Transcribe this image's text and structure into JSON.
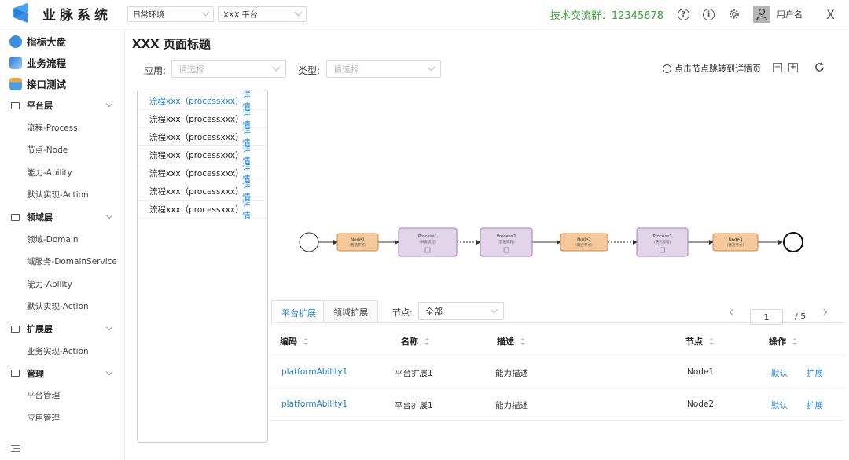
{
  "app": {
    "title": "业脉系统"
  },
  "header": {
    "env_select": "日常环境",
    "platform_select": "XXX 平台",
    "contact": "技术交流群：12345678",
    "help_glyph": "?",
    "info_glyph": "i",
    "username": "用户名",
    "close_glyph": "X"
  },
  "sidebar": {
    "top_items": [
      {
        "label": "指标大盘",
        "icon": "dashboard-icon",
        "color": "#3b8fe0"
      },
      {
        "label": "业务流程",
        "icon": "flow-icon",
        "color": "#2b78d4"
      },
      {
        "label": "接口测试",
        "icon": "api-test-icon",
        "color": "#4a9ee8"
      }
    ],
    "groups": [
      {
        "label": "平台层",
        "items": [
          "流程-Process",
          "节点-Node",
          "能力-Ability",
          "默认实现-Action"
        ]
      },
      {
        "label": "领域层",
        "items": [
          "领域-Domain",
          "域服务-DomainService",
          "能力-Ability",
          "默认实现-Action"
        ]
      },
      {
        "label": "扩展层",
        "items": [
          "业务实现-Action"
        ]
      },
      {
        "label": "管理",
        "items": [
          "平台管理",
          "应用管理"
        ]
      }
    ]
  },
  "main": {
    "page_title": "XXX 页面标题",
    "filters": {
      "app_label": "应用:",
      "app_placeholder": "请选择",
      "type_label": "类型:",
      "type_placeholder": "请选择"
    },
    "hint": "点击节点跳转到详情页",
    "zoom_out": "−",
    "zoom_in": "+",
    "process_list": [
      {
        "name": "流程xxx（processxxx）",
        "detail": "详情",
        "active": true
      },
      {
        "name": "流程xxx（processxxx）",
        "detail": "详情",
        "active": false
      },
      {
        "name": "流程xxx（processxxx）",
        "detail": "详情",
        "active": false
      },
      {
        "name": "流程xxx（processxxx）",
        "detail": "详情",
        "active": false
      },
      {
        "name": "流程xxx（processxxx）",
        "detail": "详情",
        "active": false
      },
      {
        "name": "流程xxx（processxxx）",
        "detail": "详情",
        "active": false
      },
      {
        "name": "流程xxx（processxxx）",
        "detail": "详情",
        "active": false
      }
    ],
    "flow_nodes": [
      {
        "title": "Node1",
        "sub": "(普通节点)",
        "kind": "node"
      },
      {
        "title": "Process1",
        "sub": "(并发流程)",
        "kind": "process"
      },
      {
        "title": "Process2",
        "sub": "(普通流程)",
        "kind": "process"
      },
      {
        "title": "Node2",
        "sub": "(聚合节点)",
        "kind": "node"
      },
      {
        "title": "Process3",
        "sub": "(迭代流程)",
        "kind": "process"
      },
      {
        "title": "Node3",
        "sub": "(普通节点)",
        "kind": "node"
      }
    ],
    "tabs": [
      "平台扩展",
      "领域扩展"
    ],
    "node_filter": {
      "label": "节点:",
      "value": "全部"
    },
    "pager": {
      "current": "1",
      "total": "/ 5"
    },
    "table": {
      "columns": [
        "编码",
        "名称",
        "描述",
        "节点",
        "操作"
      ],
      "rows": [
        {
          "code": "platformAbility1",
          "name": "平台扩展1",
          "desc": "能力描述",
          "node": "Node1",
          "act1": "默认",
          "act2": "扩展"
        },
        {
          "code": "platformAbility1",
          "name": "平台扩展1",
          "desc": "能力描述",
          "node": "Node2",
          "act1": "默认",
          "act2": "扩展"
        }
      ]
    }
  },
  "colors": {
    "accent": "#1e7fd8",
    "contact_green": "#3ca13c",
    "node_fill": "#f7c99a",
    "node_stroke": "#c98a4a",
    "process_fill": "#e2d5ea",
    "process_stroke": "#9c86b0"
  }
}
